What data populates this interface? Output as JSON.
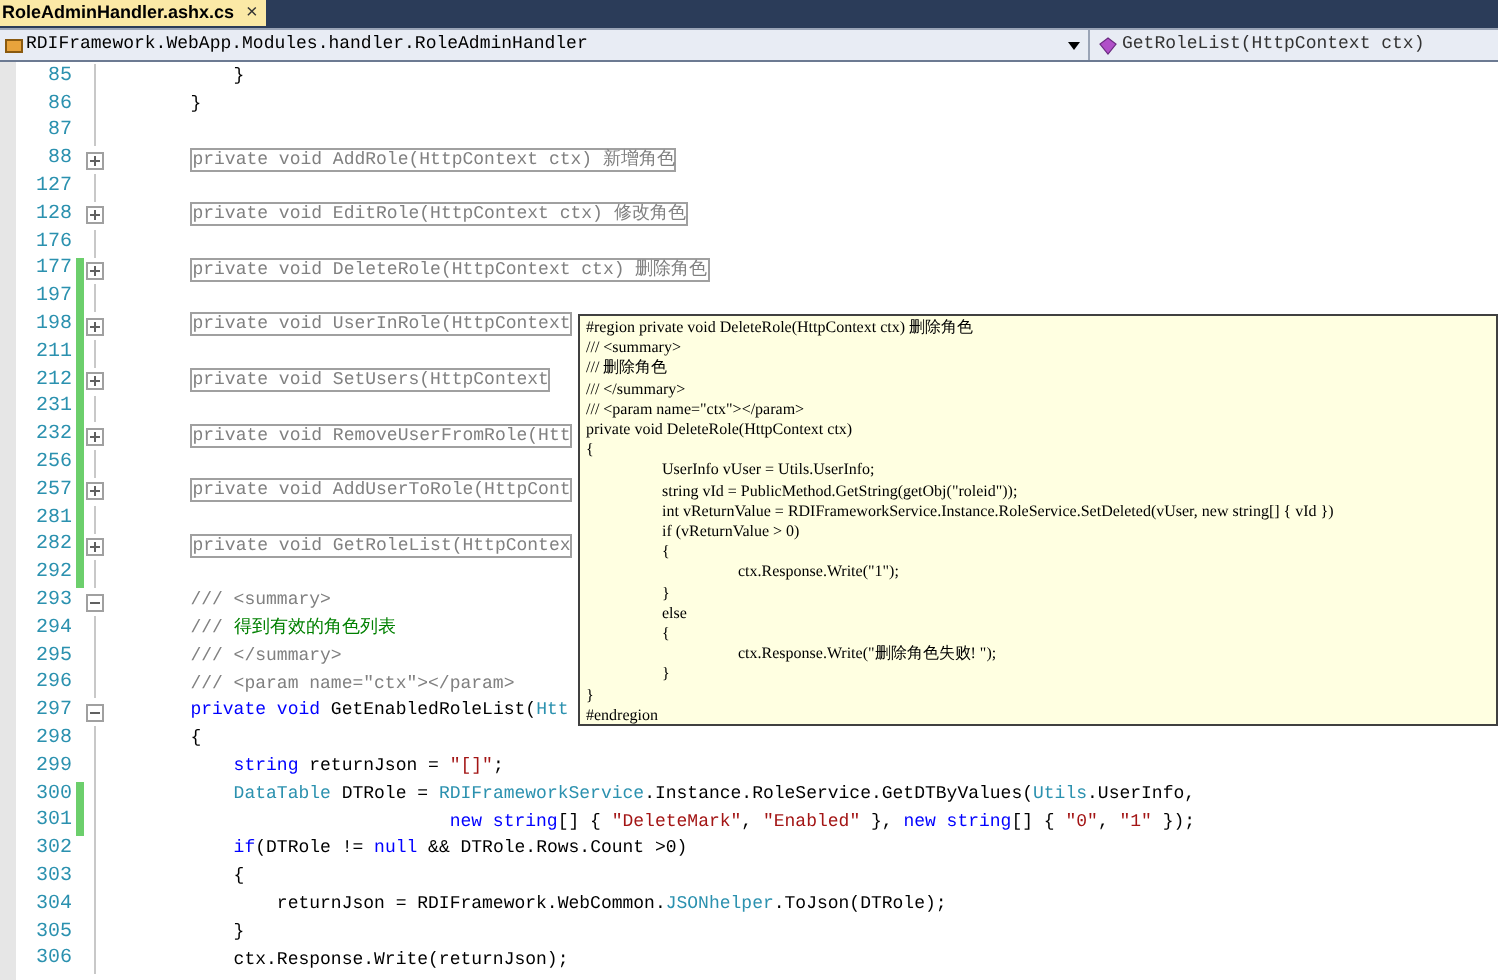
{
  "tab": {
    "title": "RoleAdminHandler.ashx.cs",
    "close": "×"
  },
  "nav": {
    "class_name": "RDIFramework.WebApp.Modules.handler.RoleAdminHandler",
    "member": "GetRoleList(HttpContext ctx)"
  },
  "lines": [
    {
      "number": "85",
      "changed": false,
      "kind": "code",
      "segments": [
        {
          "kind": "plain",
          "text": "            }"
        }
      ]
    },
    {
      "number": "86",
      "changed": false,
      "kind": "code",
      "segments": [
        {
          "kind": "plain",
          "text": "        }"
        }
      ]
    },
    {
      "number": "87",
      "changed": false,
      "kind": "code"
    },
    {
      "number": "88",
      "changed": false,
      "expanded": false,
      "kind": "collapsed",
      "text": "private void AddRole(HttpContext ctx) 新增角色"
    },
    {
      "number": "127",
      "changed": false,
      "kind": "code"
    },
    {
      "number": "128",
      "changed": false,
      "expanded": false,
      "kind": "collapsed",
      "text": "private void EditRole(HttpContext ctx) 修改角色"
    },
    {
      "number": "176",
      "changed": false,
      "kind": "code"
    },
    {
      "number": "177",
      "changed": true,
      "expanded": false,
      "kind": "collapsed",
      "text": "private void DeleteRole(HttpContext ctx) 删除角色"
    },
    {
      "number": "197",
      "changed": true,
      "kind": "code"
    },
    {
      "number": "198",
      "changed": true,
      "expanded": false,
      "kind": "collapsed",
      "text": "private void UserInRole(HttpContext"
    },
    {
      "number": "211",
      "changed": true,
      "kind": "code"
    },
    {
      "number": "212",
      "changed": true,
      "expanded": false,
      "kind": "collapsed",
      "text": "private void SetUsers(HttpContext"
    },
    {
      "number": "231",
      "changed": true,
      "kind": "code"
    },
    {
      "number": "232",
      "changed": true,
      "expanded": false,
      "kind": "collapsed",
      "text": "private void RemoveUserFromRole(Htt"
    },
    {
      "number": "256",
      "changed": true,
      "kind": "code"
    },
    {
      "number": "257",
      "changed": true,
      "expanded": false,
      "kind": "collapsed",
      "text": "private void AddUserToRole(HttpCont"
    },
    {
      "number": "281",
      "changed": true,
      "kind": "code"
    },
    {
      "number": "282",
      "changed": true,
      "expanded": false,
      "kind": "collapsed",
      "text": "private void GetRoleList(HttpContex"
    },
    {
      "number": "292",
      "changed": true,
      "kind": "code"
    },
    {
      "number": "293",
      "changed": false,
      "expanded": true,
      "kind": "code",
      "segments": [
        {
          "kind": "doc",
          "text": "        /// <summary>"
        }
      ]
    },
    {
      "number": "294",
      "changed": false,
      "kind": "code",
      "segments": [
        {
          "kind": "doc",
          "text": "        /// "
        },
        {
          "kind": "comment",
          "text": "得到有效的角色列表"
        }
      ]
    },
    {
      "number": "295",
      "changed": false,
      "kind": "code",
      "segments": [
        {
          "kind": "doc",
          "text": "        /// </summary>"
        }
      ]
    },
    {
      "number": "296",
      "changed": false,
      "kind": "code",
      "segments": [
        {
          "kind": "doc",
          "text": "        /// <param name=\"ctx\"></param>"
        }
      ]
    },
    {
      "number": "297",
      "changed": false,
      "expanded": true,
      "kind": "code",
      "segments": [
        {
          "kind": "kw",
          "text": "        private void"
        },
        {
          "kind": "plain",
          "text": " GetEnabledRoleList("
        },
        {
          "kind": "type",
          "text": "Htt"
        }
      ]
    },
    {
      "number": "298",
      "changed": false,
      "kind": "code",
      "segments": [
        {
          "kind": "plain",
          "text": "        {"
        }
      ]
    },
    {
      "number": "299",
      "changed": false,
      "kind": "code",
      "segments": [
        {
          "kind": "kw",
          "text": "            string"
        },
        {
          "kind": "plain",
          "text": " returnJson = "
        },
        {
          "kind": "str",
          "text": "\"[]\""
        },
        {
          "kind": "plain",
          "text": ";"
        }
      ]
    },
    {
      "number": "300",
      "changed": true,
      "kind": "code",
      "segments": [
        {
          "kind": "type",
          "text": "            DataTable"
        },
        {
          "kind": "plain",
          "text": " DTRole = "
        },
        {
          "kind": "type",
          "text": "RDIFrameworkService"
        },
        {
          "kind": "plain",
          "text": ".Instance.RoleService.GetDTByValues("
        },
        {
          "kind": "type",
          "text": "Utils"
        },
        {
          "kind": "plain",
          "text": ".UserInfo,"
        }
      ]
    },
    {
      "number": "301",
      "changed": true,
      "kind": "code",
      "segments": [
        {
          "kind": "kw",
          "text": "                                new string"
        },
        {
          "kind": "plain",
          "text": "[] { "
        },
        {
          "kind": "str",
          "text": "\"DeleteMark\""
        },
        {
          "kind": "plain",
          "text": ", "
        },
        {
          "kind": "str",
          "text": "\"Enabled\""
        },
        {
          "kind": "plain",
          "text": " }, "
        },
        {
          "kind": "kw",
          "text": "new string"
        },
        {
          "kind": "plain",
          "text": "[] { "
        },
        {
          "kind": "str",
          "text": "\"0\""
        },
        {
          "kind": "plain",
          "text": ", "
        },
        {
          "kind": "str",
          "text": "\"1\""
        },
        {
          "kind": "plain",
          "text": " });"
        }
      ]
    },
    {
      "number": "302",
      "changed": false,
      "kind": "code",
      "segments": [
        {
          "kind": "kw",
          "text": "            if"
        },
        {
          "kind": "plain",
          "text": "(DTRole != "
        },
        {
          "kind": "kw",
          "text": "null"
        },
        {
          "kind": "plain",
          "text": " && DTRole.Rows.Count >0)"
        }
      ]
    },
    {
      "number": "303",
      "changed": false,
      "kind": "code",
      "segments": [
        {
          "kind": "plain",
          "text": "            {"
        }
      ]
    },
    {
      "number": "304",
      "changed": false,
      "kind": "code",
      "segments": [
        {
          "kind": "plain",
          "text": "                returnJson = RDIFramework.WebCommon."
        },
        {
          "kind": "type",
          "text": "JSONhelper"
        },
        {
          "kind": "plain",
          "text": ".ToJson(DTRole);"
        }
      ]
    },
    {
      "number": "305",
      "changed": false,
      "kind": "code",
      "segments": [
        {
          "kind": "plain",
          "text": "            }"
        }
      ]
    },
    {
      "number": "306",
      "changed": false,
      "kind": "code",
      "segments": [
        {
          "kind": "plain",
          "text": "            ctx.Response.Write(returnJson);"
        }
      ]
    }
  ],
  "tooltip": {
    "lines": [
      "#region private void DeleteRole(HttpContext ctx) 删除角色",
      "/// <summary>",
      "/// 删除角色",
      "/// </summary>",
      "/// <param name=\"ctx\"></param>",
      "private void DeleteRole(HttpContext ctx)",
      "{",
      "\tUserInfo vUser = Utils.UserInfo;",
      "\tstring vId = PublicMethod.GetString(getObj(\"roleid\"));",
      "\tint vReturnValue = RDIFrameworkService.Instance.RoleService.SetDeleted(vUser, new string[] { vId })",
      "\tif (vReturnValue > 0)",
      "\t{",
      "\t\tctx.Response.Write(\"1\");",
      "\t}",
      "\telse",
      "\t{",
      "\t\tctx.Response.Write(\"删除角色失败! \");",
      "\t}",
      "}",
      "#endregion"
    ]
  }
}
